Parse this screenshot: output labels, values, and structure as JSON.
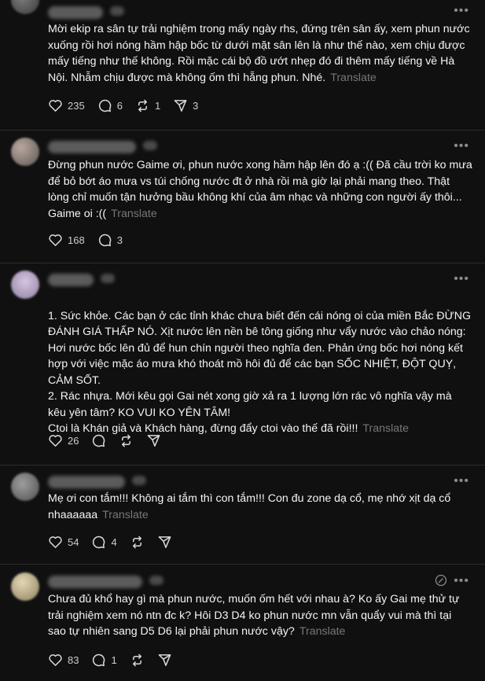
{
  "translate_label": "Translate",
  "colors": {
    "background": "#101010",
    "text": "#f3f5f7",
    "muted": "#777777",
    "divider": "#2d2d2d"
  },
  "posts": [
    {
      "text": "Mời ekip ra sân tự trải nghiệm trong mấy ngày rhs, đứng trên sân ấy, xem phun nước xuống rồi hơi nóng hầm hập bốc từ dưới mặt sân lên là như thế nào, xem chịu được mấy tiếng như thế không. Rồi mặc cái bộ đồ ướt nhẹp đó đi thêm mấy tiếng về Hà Nội. Nhẫm chịu được mà không ốm thì hẵng phun. Nhé.",
      "likes": "235",
      "comments": "6",
      "reposts": "1",
      "shares": "3"
    },
    {
      "text": "Đừng phun nước Gaime ơi, phun nước xong hầm hập lên đó ạ :(( Đã cầu trời ko mưa để bỏ bớt áo mưa vs túi chống nước đt ở nhà rồi mà giờ lại phải mang theo. Thật lòng chỉ muốn tận hưởng bầu không khí của âm nhạc và những con người ấy thôi... Gaime oi :((",
      "likes": "168",
      "comments": "3",
      "reposts": "",
      "shares": ""
    },
    {
      "text": "1. Sức khỏe. Các bạn ở các tỉnh khác chưa biết đến cái nóng oi của miền Bắc ĐỪNG ĐÁNH GIÁ THẤP NÓ. Xịt nước lên nền bê tông giống như vẩy nước vào chảo nóng: Hơi nước bốc lên đủ để hun chín người theo nghĩa đen. Phản ứng bốc hơi nóng kết hợp với việc mặc áo mưa khó thoát mồ hôi đủ để các bạn SỐC NHIỆT, ĐỘT QUỴ, CẢM SỐT.\n2. Rác nhựa. Mới kêu gọi Gai nét xong giờ xả ra 1 lượng lớn rác vô nghĩa vậy mà kêu yên tâm? KO VUI KO YÊN TÂM!\nCtoi là Khán giả và Khách hàng, đừng đẩy ctoi vào thế đã rồi!!!",
      "likes": "26",
      "comments": "",
      "reposts": "",
      "shares": ""
    },
    {
      "text": "Mẹ ơi con tắm!!! Không ai tắm thì con tắm!!! Con đu zone dạ cổ, mẹ nhớ xịt dạ cổ nhaaaaaa",
      "likes": "54",
      "comments": "4",
      "reposts": "",
      "shares": ""
    },
    {
      "text": "Chưa đủ khổ hay gì mà phun nước, muốn ốm hết với nhau à? Ko ấy Gai mẹ thử tự trải nghiệm xem nó ntn đc k? Hôi D3 D4 ko phun nước mn vẫn quẩy vui mà thì tại sao tự nhiên sang D5 D6 lại phải phun nước vậy?",
      "likes": "83",
      "comments": "1",
      "reposts": "",
      "shares": ""
    }
  ]
}
